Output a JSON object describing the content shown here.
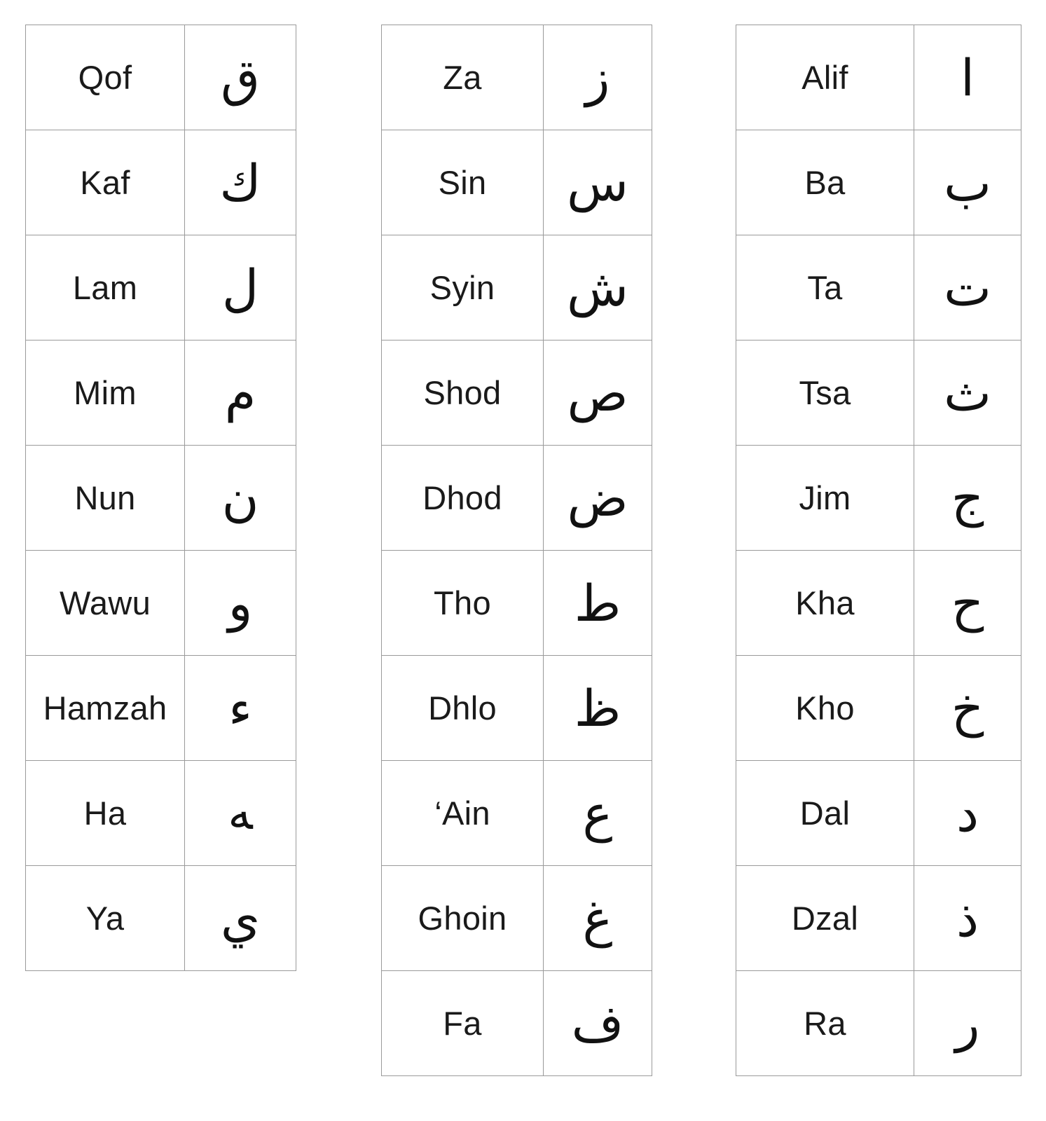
{
  "page": {
    "title": "Huruf Hijaiyah Letter Chart",
    "background_color": "#ffffff",
    "text_color": "#1a1a1a",
    "border_color": "#9a9a9a"
  },
  "columns": [
    {
      "id": "col-1",
      "rows": [
        {
          "name": "Qof",
          "glyph": "ق"
        },
        {
          "name": "Kaf",
          "glyph": "ك"
        },
        {
          "name": "Lam",
          "glyph": "ل"
        },
        {
          "name": "Mim",
          "glyph": "م"
        },
        {
          "name": "Nun",
          "glyph": "ن"
        },
        {
          "name": "Wawu",
          "glyph": "و"
        },
        {
          "name": "Hamzah",
          "glyph": "ء"
        },
        {
          "name": "Ha",
          "glyph": "ﻪ"
        },
        {
          "name": "Ya",
          "glyph": "ي"
        }
      ]
    },
    {
      "id": "col-2",
      "rows": [
        {
          "name": "Za",
          "glyph": "ز"
        },
        {
          "name": "Sin",
          "glyph": "س"
        },
        {
          "name": "Syin",
          "glyph": "ش"
        },
        {
          "name": "Shod",
          "glyph": "ص"
        },
        {
          "name": "Dhod",
          "glyph": "ض"
        },
        {
          "name": "Tho",
          "glyph": "ط"
        },
        {
          "name": "Dhlo",
          "glyph": "ظ"
        },
        {
          "name": "‘Ain",
          "glyph": "ع"
        },
        {
          "name": "Ghoin",
          "glyph": "غ"
        },
        {
          "name": "Fa",
          "glyph": "ف"
        }
      ]
    },
    {
      "id": "col-3",
      "rows": [
        {
          "name": "Alif",
          "glyph": "ا"
        },
        {
          "name": "Ba",
          "glyph": "ب"
        },
        {
          "name": "Ta",
          "glyph": "ت"
        },
        {
          "name": "Tsa",
          "glyph": "ث"
        },
        {
          "name": "Jim",
          "glyph": "ج"
        },
        {
          "name": "Kha",
          "glyph": "ح"
        },
        {
          "name": "Kho",
          "glyph": "خ"
        },
        {
          "name": "Dal",
          "glyph": "د"
        },
        {
          "name": "Dzal",
          "glyph": "ذ"
        },
        {
          "name": "Ra",
          "glyph": "ر"
        }
      ]
    }
  ]
}
